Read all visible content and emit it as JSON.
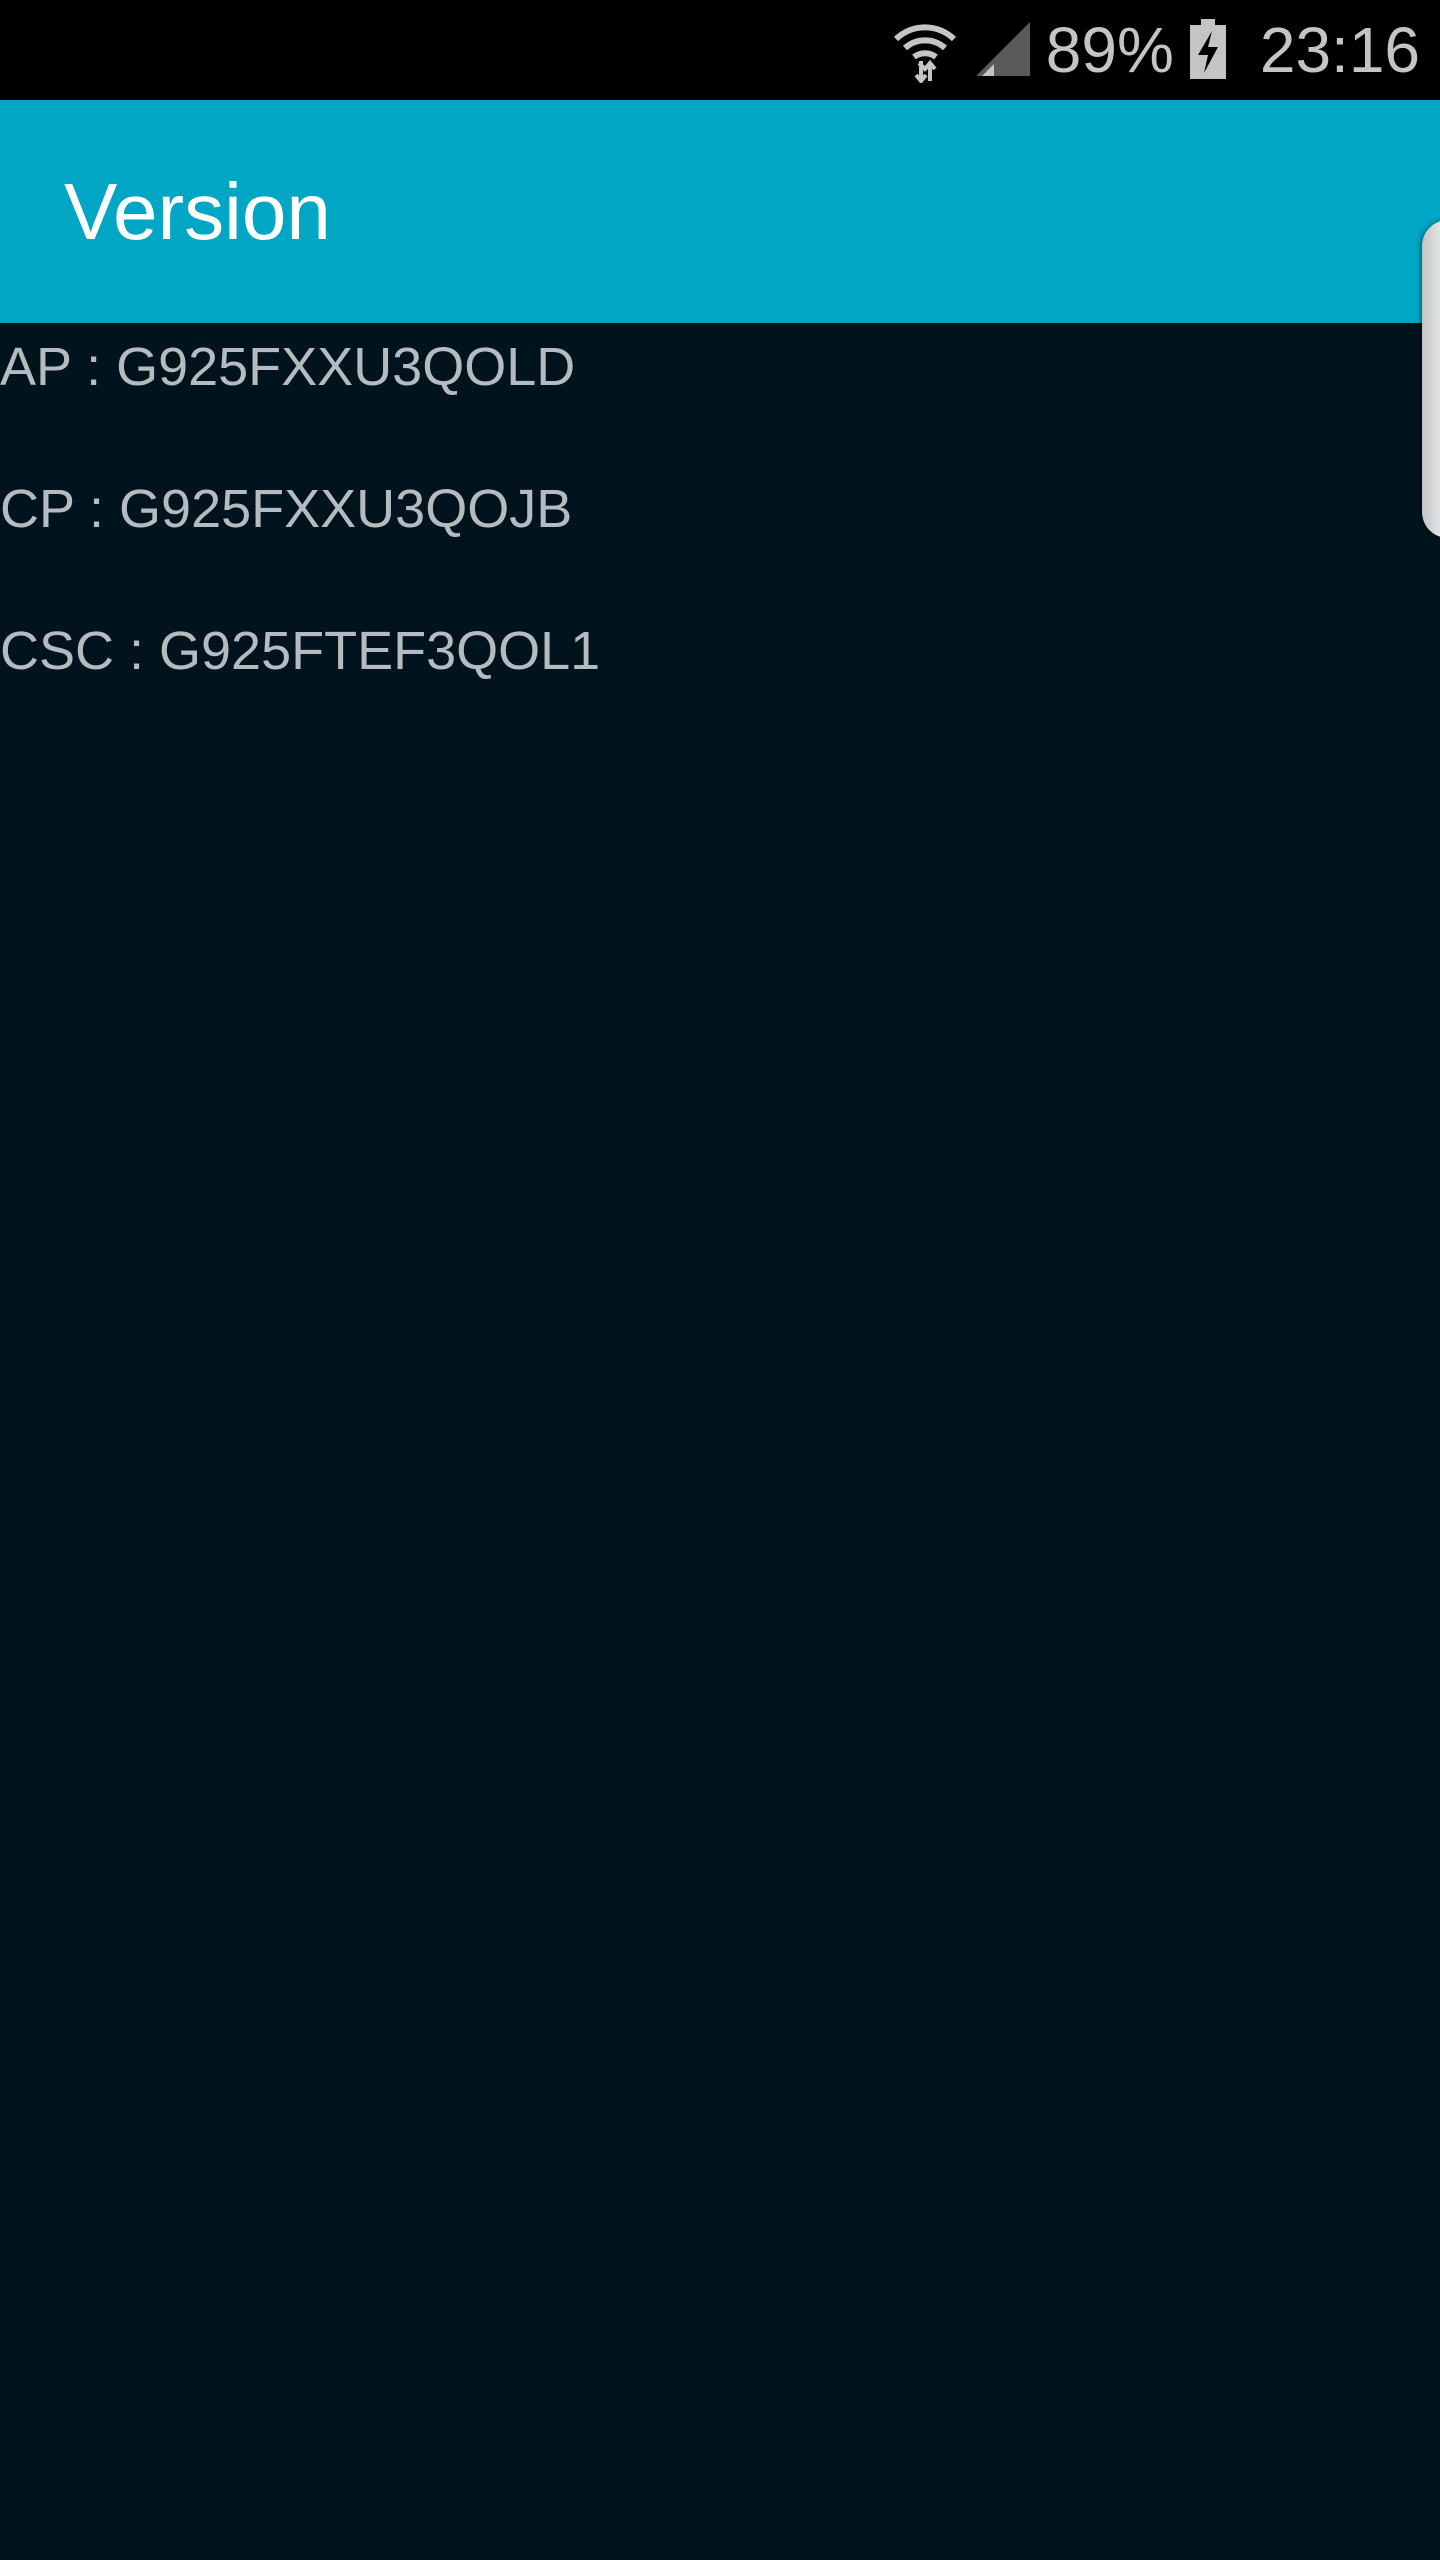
{
  "status_bar": {
    "icons": [
      "wifi-icon",
      "cellular-signal-icon",
      "battery-charging-icon"
    ],
    "battery_percent": "89%",
    "time": "23:16"
  },
  "app_bar": {
    "title": "Version",
    "color": "#00a6c4"
  },
  "versions": [
    {
      "text": "AP : G925FXXU3QOLD"
    },
    {
      "text": "CP : G925FXXU3QOJB"
    },
    {
      "text": "CSC : G925FTEF3QOL1"
    }
  ],
  "colors": {
    "background": "#01131c",
    "text": "#b4bcc0"
  }
}
